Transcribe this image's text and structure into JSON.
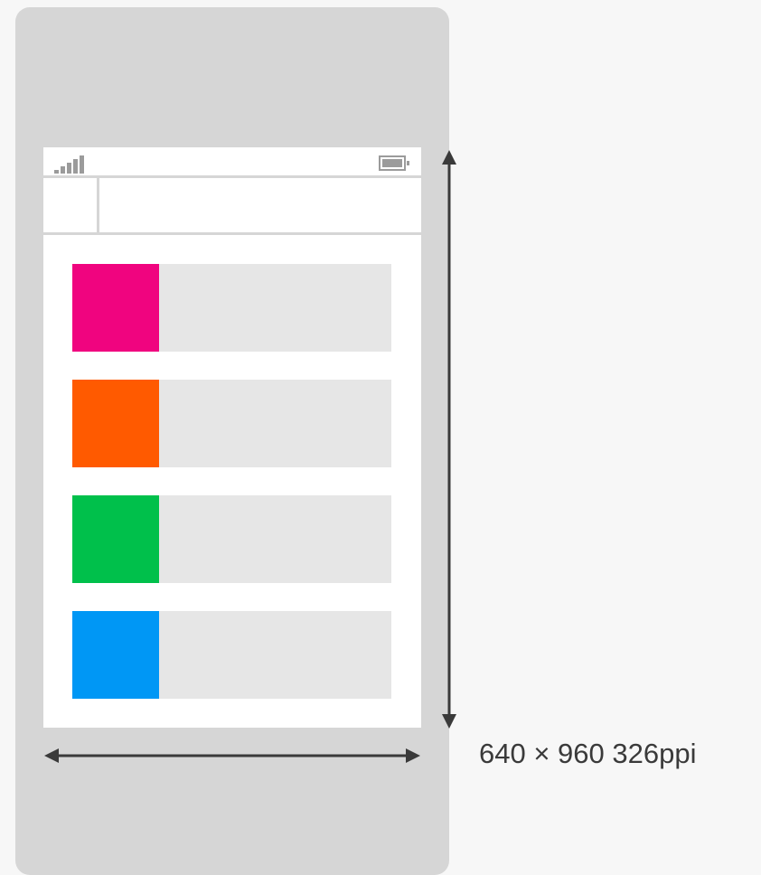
{
  "device": {
    "spec_label": "640 × 960 326ppi",
    "icons": [
      "signal-icon",
      "battery-icon"
    ]
  },
  "colors": {
    "device_frame": "#d6d6d6",
    "screen": "#ffffff",
    "list_item_bg": "#e6e6e6",
    "status_icons": "#9b9b9b",
    "arrows": "#3a3a3a"
  },
  "list_items": [
    {
      "name": "list-item-pink",
      "color": "#f0047f"
    },
    {
      "name": "list-item-orange",
      "color": "#ff5a00"
    },
    {
      "name": "list-item-green",
      "color": "#00c04b"
    },
    {
      "name": "list-item-blue",
      "color": "#0097f5"
    }
  ]
}
